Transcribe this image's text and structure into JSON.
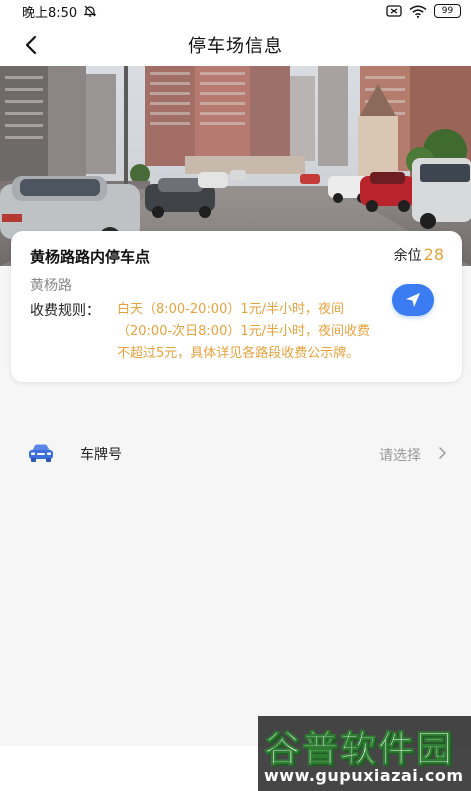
{
  "status_bar": {
    "time": "晚上8:50",
    "battery": "99",
    "icons": [
      "alarm-off-icon",
      "sim-icon",
      "wifi-icon",
      "battery-icon"
    ]
  },
  "nav": {
    "title": "停车场信息",
    "back_icon": "chevron-left-icon"
  },
  "parking": {
    "name": "黄杨路路内停车点",
    "spaces_label": "余位",
    "spaces_count": "28",
    "road": "黄杨路",
    "fee_label": "收费规则：",
    "fee_rules": "白天（8:00-20:00）1元/半小时，夜间（20:00-次日8:00）1元/半小时，夜间收费不超过5元，具体详见各路段收费公示牌。",
    "navigate_icon": "navigation-arrow-icon"
  },
  "plate": {
    "icon": "car-icon",
    "label": "车牌号",
    "placeholder": "请选择"
  },
  "watermark": {
    "main": "谷普软件园",
    "url": "www.gupuxiazai.com"
  },
  "colors": {
    "accent": "#3b7cf2",
    "highlight": "#e6a23c",
    "background": "#f6f6f7"
  }
}
